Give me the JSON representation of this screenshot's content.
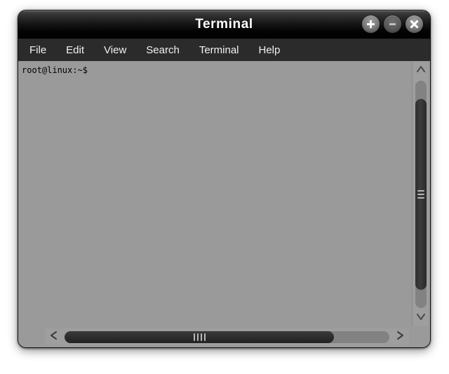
{
  "window": {
    "title": "Terminal",
    "controls": [
      {
        "name": "maximize-button",
        "icon": "plus-icon",
        "glyph": "+"
      },
      {
        "name": "minimize-button",
        "icon": "minus-icon",
        "glyph": "−"
      },
      {
        "name": "close-button",
        "icon": "close-icon",
        "glyph": "×"
      }
    ]
  },
  "menubar": {
    "items": [
      {
        "label": "File"
      },
      {
        "label": "Edit"
      },
      {
        "label": "View"
      },
      {
        "label": "Search"
      },
      {
        "label": "Terminal"
      },
      {
        "label": "Help"
      }
    ]
  },
  "terminal": {
    "prompt": "root@linux:~$",
    "lines": [
      "root@linux:~$"
    ],
    "background_color": "#9a9a9a",
    "text_color": "#000000"
  },
  "scrollbars": {
    "vertical": {
      "up_arrow_icon": "chevron-up-icon",
      "down_arrow_icon": "chevron-down-icon",
      "grip_count": 3
    },
    "horizontal": {
      "left_arrow_icon": "chevron-left-icon",
      "right_arrow_icon": "chevron-right-icon",
      "grip_count": 4
    }
  },
  "colors": {
    "titlebar": "#000000",
    "menubar": "#2b2b2b",
    "terminal_bg": "#9a9a9a",
    "scrollbar_track": "#828282",
    "scrollbar_thumb": "#2e2e2e"
  }
}
